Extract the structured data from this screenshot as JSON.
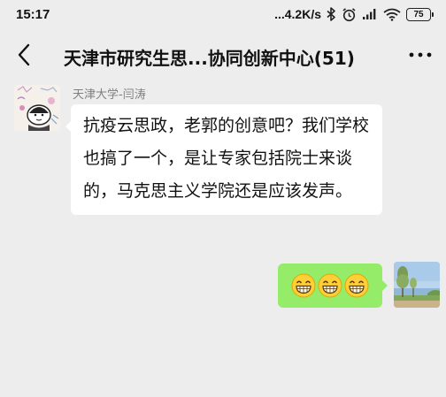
{
  "status_bar": {
    "time": "15:17",
    "network_speed": "...4.2K/s",
    "battery": "75",
    "icons": [
      "bluetooth-icon",
      "alarm-icon",
      "signal-icon",
      "wifi-icon",
      "battery-icon"
    ]
  },
  "header": {
    "back_icon": "chevron-left-icon",
    "title": "天津市研究生思...协同创新中心(51)",
    "more_icon": "more-dots-icon"
  },
  "messages": [
    {
      "side": "left",
      "sender": "天津大学-闫涛",
      "avatar_icon": "cartoon-avatar",
      "text": "抗疫云思政，老郭的创意吧？我们学校也搞了一个，是让专家包括院士来谈的，马克思主义学院还是应该发声。"
    },
    {
      "side": "right",
      "avatar_icon": "landscape-avatar",
      "emojis": [
        "grin-emoji",
        "grin-emoji",
        "grin-emoji"
      ]
    }
  ],
  "colors": {
    "background": "#ededed",
    "incoming_bubble": "#ffffff",
    "outgoing_bubble": "#95ec69",
    "sender_name": "#7f7f7f"
  }
}
